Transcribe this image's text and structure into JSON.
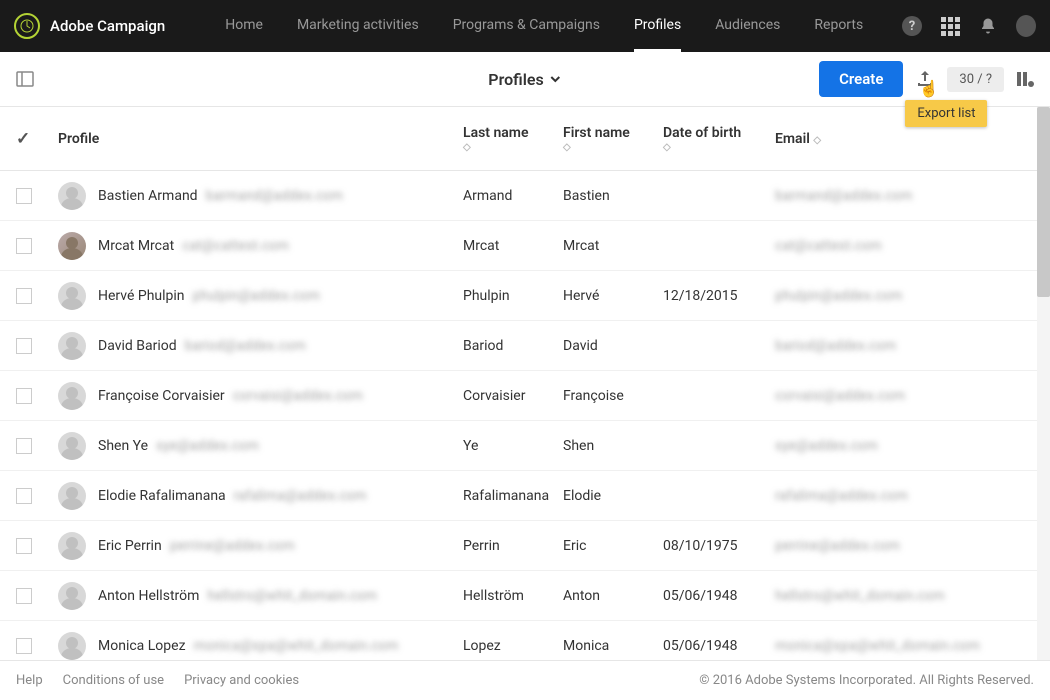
{
  "brand": {
    "name": "Adobe Campaign"
  },
  "nav": {
    "home": "Home",
    "marketing": "Marketing activities",
    "programs": "Programs & Campaigns",
    "profiles": "Profiles",
    "audiences": "Audiences",
    "reports": "Reports"
  },
  "toolbar": {
    "title": "Profiles",
    "create": "Create",
    "count": "30 / ?",
    "export_tooltip": "Export list"
  },
  "columns": {
    "profile": "Profile",
    "last": "Last name",
    "first": "First name",
    "dob": "Date of birth",
    "email": "Email"
  },
  "rows": [
    {
      "name": "Bastien Armand",
      "blur": "barmand@addex.com",
      "last": "Armand",
      "first": "Bastien",
      "dob": "",
      "email": "barmand@addex.com",
      "cat": false
    },
    {
      "name": "Mrcat Mrcat",
      "blur": "cat@cattest.com",
      "last": "Mrcat",
      "first": "Mrcat",
      "dob": "",
      "email": "cat@cattest.com",
      "cat": true
    },
    {
      "name": "Hervé Phulpin",
      "blur": "phulpin@addex.com",
      "last": "Phulpin",
      "first": "Hervé",
      "dob": "12/18/2015",
      "email": "phulpin@addex.com",
      "cat": false
    },
    {
      "name": "David Bariod",
      "blur": "bariod@addex.com",
      "last": "Bariod",
      "first": "David",
      "dob": "",
      "email": "bariod@addex.com",
      "cat": false
    },
    {
      "name": "Françoise Corvaisier",
      "blur": "corvaisi@addex.com",
      "last": "Corvaisier",
      "first": "Françoise",
      "dob": "",
      "email": "corvaisi@addex.com",
      "cat": false
    },
    {
      "name": "Shen Ye",
      "blur": "sye@addex.com",
      "last": "Ye",
      "first": "Shen",
      "dob": "",
      "email": "sye@addex.com",
      "cat": false
    },
    {
      "name": "Elodie Rafalimanana",
      "blur": "rafalima@addex.com",
      "last": "Rafalimanana",
      "first": "Elodie",
      "dob": "",
      "email": "rafalima@addex.com",
      "cat": false
    },
    {
      "name": "Eric Perrin",
      "blur": "perrine@addex.com",
      "last": "Perrin",
      "first": "Eric",
      "dob": "08/10/1975",
      "email": "perrine@addex.com",
      "cat": false
    },
    {
      "name": "Anton Hellström",
      "blur": "hellstro@whit_domain.com",
      "last": "Hellström",
      "first": "Anton",
      "dob": "05/06/1948",
      "email": "hellstro@whit_domain.com",
      "cat": false
    },
    {
      "name": "Monica Lopez",
      "blur": "monica@spa@whit_domain.com",
      "last": "Lopez",
      "first": "Monica",
      "dob": "05/06/1948",
      "email": "monica@spa@whit_domain.com",
      "cat": false
    }
  ],
  "footer": {
    "help": "Help",
    "conditions": "Conditions of use",
    "privacy": "Privacy and cookies",
    "copyright": "© 2016 Adobe Systems Incorporated. All Rights Reserved."
  }
}
